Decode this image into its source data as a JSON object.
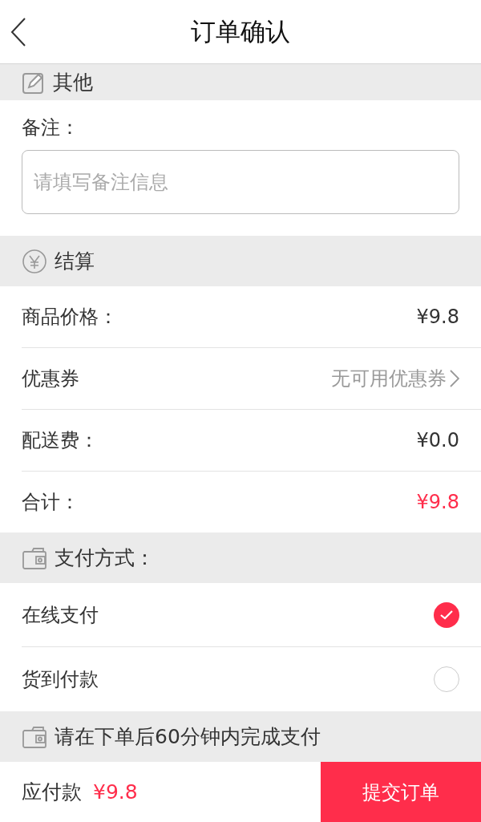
{
  "header": {
    "title": "订单确认"
  },
  "remark_section": {
    "title": "其他",
    "label": "备注：",
    "placeholder": "请填写备注信息"
  },
  "settlement_section": {
    "title": "结算"
  },
  "settlement_rows": [
    {
      "kind": "value",
      "label": "商品价格：",
      "value": "¥9.8"
    },
    {
      "kind": "link",
      "label": "优惠券",
      "value": "无可用优惠券"
    },
    {
      "kind": "value",
      "label": "配送费：",
      "value": "¥0.0"
    },
    {
      "kind": "total",
      "label": "合计：",
      "value": "¥9.8"
    }
  ],
  "payment_section": {
    "title": "支付方式："
  },
  "payment_options": [
    {
      "label": "在线支付",
      "selected": true
    },
    {
      "label": "货到付款",
      "selected": false
    }
  ],
  "notice_section": {
    "title": "请在下单后60分钟内完成支付"
  },
  "footer": {
    "label": "应付款",
    "amount": "¥9.8",
    "button": "提交订单"
  }
}
